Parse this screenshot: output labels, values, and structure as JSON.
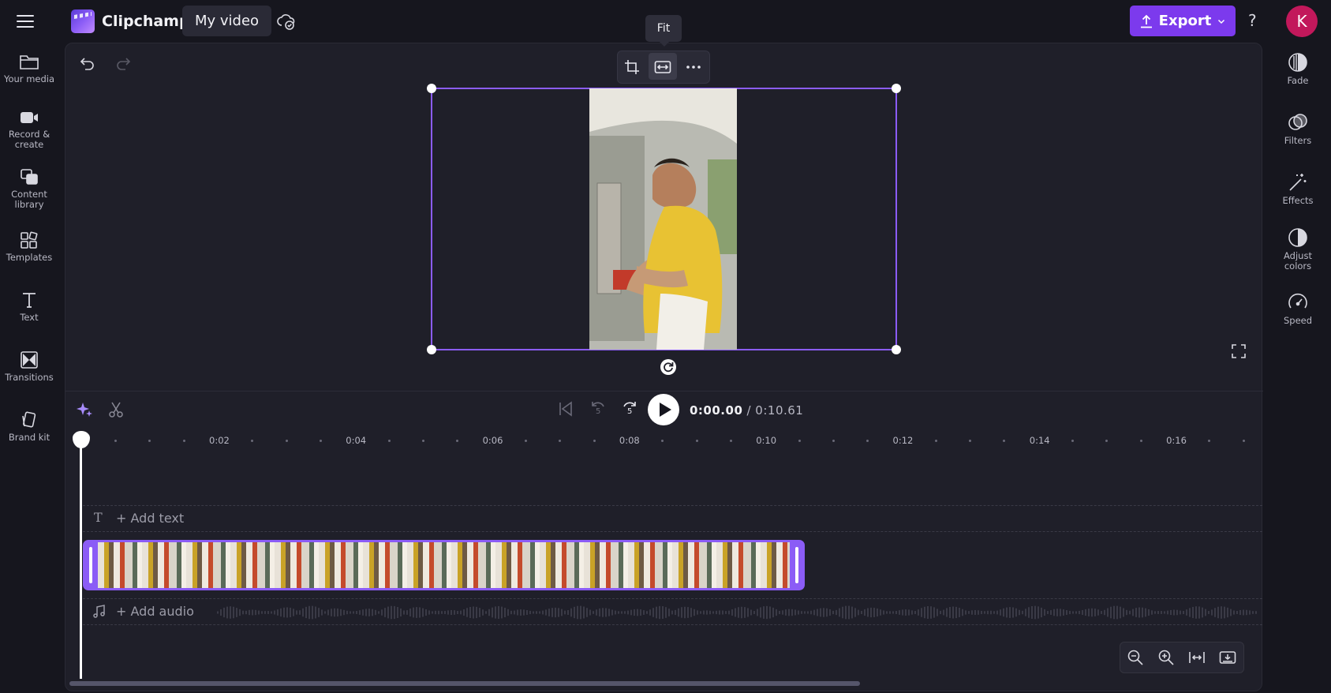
{
  "app": {
    "name": "Clipchamp",
    "project_title": "My video",
    "export_label": "Export",
    "help_label": "?",
    "avatar_initial": "K"
  },
  "left_sidebar": {
    "items": [
      {
        "label": "Your media",
        "icon": "folder-icon"
      },
      {
        "label": "Record & create",
        "icon": "camera-icon"
      },
      {
        "label": "Content library",
        "icon": "library-icon"
      },
      {
        "label": "Templates",
        "icon": "templates-icon"
      },
      {
        "label": "Text",
        "icon": "text-icon"
      },
      {
        "label": "Transitions",
        "icon": "transitions-icon"
      },
      {
        "label": "Brand kit",
        "icon": "brand-kit-icon"
      }
    ]
  },
  "right_sidebar": {
    "items": [
      {
        "label": "Fade",
        "icon": "fade-icon"
      },
      {
        "label": "Filters",
        "icon": "filters-icon"
      },
      {
        "label": "Effects",
        "icon": "effects-icon"
      },
      {
        "label": "Adjust colors",
        "icon": "adjust-colors-icon"
      },
      {
        "label": "Speed",
        "icon": "speed-icon"
      }
    ]
  },
  "preview": {
    "tooltip": "Fit"
  },
  "playback": {
    "current_time": "0:00.00",
    "total_time": "/ 0:10.61",
    "skip_back_label": "5",
    "skip_forward_label": "5"
  },
  "ruler": {
    "labels": [
      "0:02",
      "0:04",
      "0:06",
      "0:08",
      "0:10",
      "0:12",
      "0:14",
      "0:16"
    ]
  },
  "tracks": {
    "text_placeholder": "+ Add text",
    "audio_placeholder": "+ Add audio"
  },
  "colors": {
    "accent": "#8b5cf6",
    "export": "#7c3aed",
    "avatar": "#c2185b",
    "background": "#16161e",
    "panel": "#1f1f29"
  }
}
